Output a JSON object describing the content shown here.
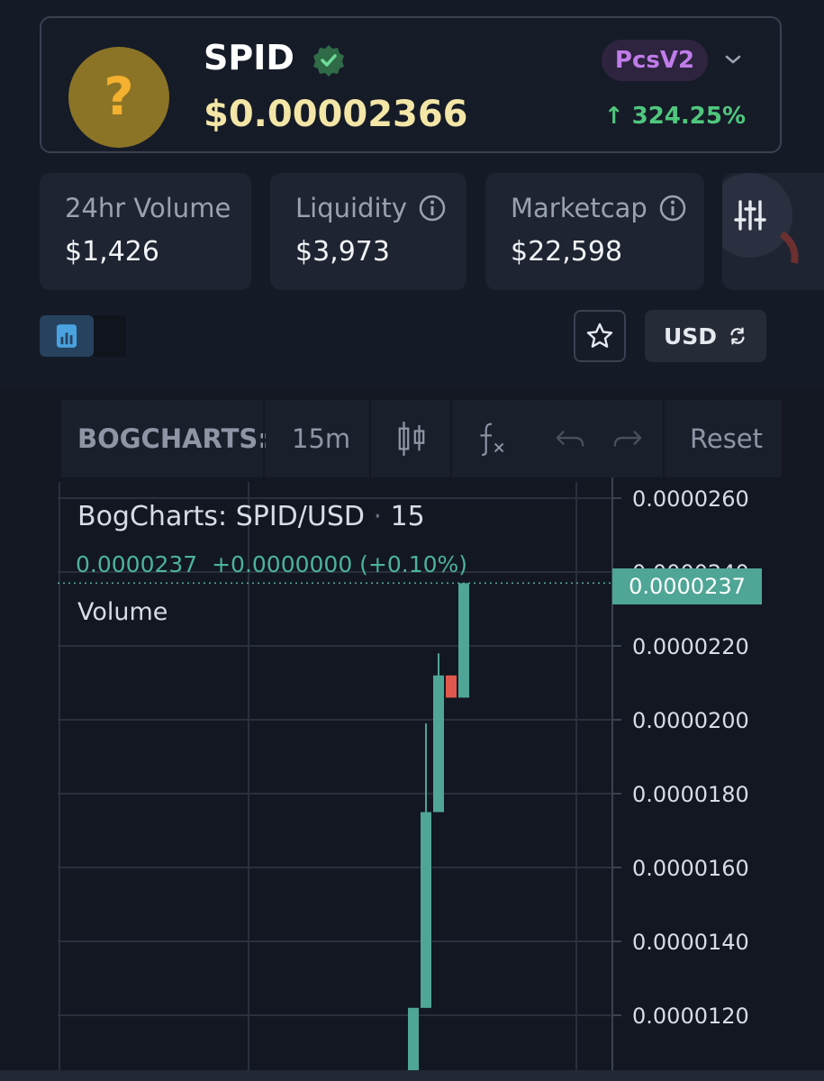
{
  "token": {
    "symbol": "SPID",
    "price": "$0.00002366",
    "dex": "PcsV2",
    "change": "324.25%",
    "logo_glyph": "?"
  },
  "stats": [
    {
      "label": "24hr Volume",
      "value": "$1,426"
    },
    {
      "label": "Liquidity",
      "value": "$3,973"
    },
    {
      "label": "Marketcap",
      "value": "$22,598"
    }
  ],
  "controls": {
    "currency": "USD"
  },
  "toolbar": {
    "brand": "BOGCHARTS:",
    "interval": "15m",
    "reset": "Reset"
  },
  "chart_legend": {
    "title": "BogCharts: SPID/USD",
    "interval": "15",
    "values": "0.0000237  +0.0000000 (+0.10%)",
    "volume_label": "Volume",
    "current_price": "0.0000237"
  },
  "colors": {
    "up": "#4fa696",
    "down": "#e0584d",
    "accent_green": "#4fc77d",
    "dex_purple": "#c07ce8"
  },
  "chart_data": {
    "type": "candlestick",
    "y_ticks": [
      "0.0000260",
      "0.0000240",
      "0.0000220",
      "0.0000200",
      "0.0000180",
      "0.0000160",
      "0.0000140",
      "0.0000120"
    ],
    "ylim": [
      1.11e-05,
      2.64e-05
    ],
    "candles": [
      {
        "open": 1.22e-05,
        "close": 1.11e-05,
        "high": 1.22e-05,
        "low": 1.11e-05,
        "direction": "up"
      },
      {
        "open": 1.22e-05,
        "close": 1.75e-05,
        "high": 1.99e-05,
        "low": 1.22e-05,
        "direction": "up"
      },
      {
        "open": 1.75e-05,
        "close": 2.12e-05,
        "high": 2.18e-05,
        "low": 1.75e-05,
        "direction": "up"
      },
      {
        "open": 2.12e-05,
        "close": 2.06e-05,
        "high": 2.12e-05,
        "low": 2.06e-05,
        "direction": "down"
      },
      {
        "open": 2.06e-05,
        "close": 2.37e-05,
        "high": 2.37e-05,
        "low": 2.06e-05,
        "direction": "up"
      }
    ],
    "last_price": 2.37e-05
  }
}
